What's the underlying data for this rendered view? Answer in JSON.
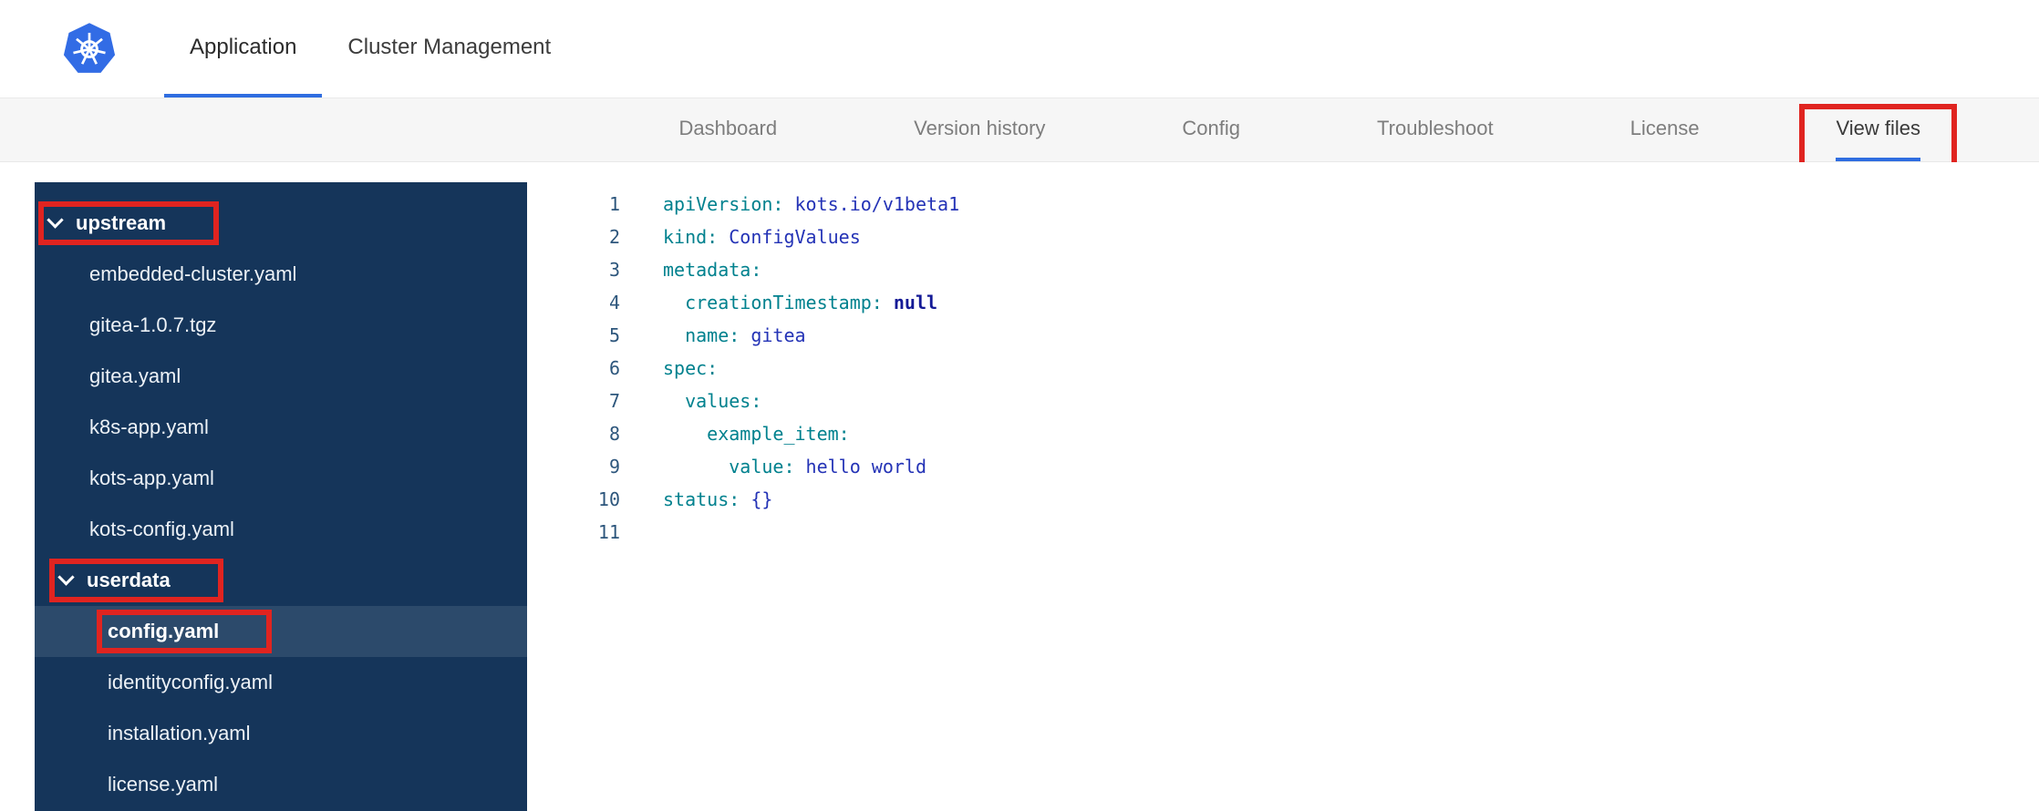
{
  "header": {
    "logo": "kubernetes-logo",
    "tabs": [
      {
        "label": "Application",
        "active": true
      },
      {
        "label": "Cluster Management",
        "active": false
      }
    ]
  },
  "subnav": {
    "tabs": [
      {
        "label": "Dashboard",
        "active": false,
        "annotated": false
      },
      {
        "label": "Version history",
        "active": false,
        "annotated": false
      },
      {
        "label": "Config",
        "active": false,
        "annotated": false
      },
      {
        "label": "Troubleshoot",
        "active": false,
        "annotated": false
      },
      {
        "label": "License",
        "active": false,
        "annotated": false
      },
      {
        "label": "View files",
        "active": true,
        "annotated": true
      }
    ]
  },
  "file_tree": {
    "items": [
      {
        "type": "folder",
        "label": "upstream",
        "expanded": true,
        "nested": false,
        "selected": false,
        "annotated": true
      },
      {
        "type": "file",
        "label": "embedded-cluster.yaml",
        "nested": false,
        "selected": false,
        "annotated": false
      },
      {
        "type": "file",
        "label": "gitea-1.0.7.tgz",
        "nested": false,
        "selected": false,
        "annotated": false
      },
      {
        "type": "file",
        "label": "gitea.yaml",
        "nested": false,
        "selected": false,
        "annotated": false
      },
      {
        "type": "file",
        "label": "k8s-app.yaml",
        "nested": false,
        "selected": false,
        "annotated": false
      },
      {
        "type": "file",
        "label": "kots-app.yaml",
        "nested": false,
        "selected": false,
        "annotated": false
      },
      {
        "type": "file",
        "label": "kots-config.yaml",
        "nested": false,
        "selected": false,
        "annotated": false
      },
      {
        "type": "folder",
        "label": "userdata",
        "expanded": true,
        "nested": true,
        "selected": false,
        "annotated": true
      },
      {
        "type": "file",
        "label": "config.yaml",
        "nested": true,
        "selected": true,
        "annotated": true
      },
      {
        "type": "file",
        "label": "identityconfig.yaml",
        "nested": true,
        "selected": false,
        "annotated": false
      },
      {
        "type": "file",
        "label": "installation.yaml",
        "nested": true,
        "selected": false,
        "annotated": false
      },
      {
        "type": "file",
        "label": "license.yaml",
        "nested": true,
        "selected": false,
        "annotated": false
      }
    ]
  },
  "editor": {
    "lines": [
      {
        "n": "1",
        "segments": [
          {
            "t": "key",
            "s": "apiVersion:"
          },
          {
            "t": "val",
            "s": " kots.io/v1beta1"
          }
        ]
      },
      {
        "n": "2",
        "segments": [
          {
            "t": "key",
            "s": "kind:"
          },
          {
            "t": "val",
            "s": " ConfigValues"
          }
        ]
      },
      {
        "n": "3",
        "segments": [
          {
            "t": "key",
            "s": "metadata:"
          }
        ]
      },
      {
        "n": "4",
        "segments": [
          {
            "t": "plain",
            "s": "  "
          },
          {
            "t": "key",
            "s": "creationTimestamp:"
          },
          {
            "t": "const",
            "s": " null"
          }
        ]
      },
      {
        "n": "5",
        "segments": [
          {
            "t": "plain",
            "s": "  "
          },
          {
            "t": "key",
            "s": "name:"
          },
          {
            "t": "val",
            "s": " gitea"
          }
        ]
      },
      {
        "n": "6",
        "segments": [
          {
            "t": "key",
            "s": "spec:"
          }
        ]
      },
      {
        "n": "7",
        "segments": [
          {
            "t": "plain",
            "s": "  "
          },
          {
            "t": "key",
            "s": "values:"
          }
        ]
      },
      {
        "n": "8",
        "segments": [
          {
            "t": "plain",
            "s": "    "
          },
          {
            "t": "key",
            "s": "example_item:"
          }
        ]
      },
      {
        "n": "9",
        "segments": [
          {
            "t": "plain",
            "s": "      "
          },
          {
            "t": "key",
            "s": "value:"
          },
          {
            "t": "val",
            "s": " hello world"
          }
        ]
      },
      {
        "n": "10",
        "segments": [
          {
            "t": "key",
            "s": "status:"
          },
          {
            "t": "val",
            "s": " {}"
          }
        ]
      },
      {
        "n": "11",
        "segments": []
      }
    ]
  },
  "annotations": {
    "color": "#e02420",
    "targets": [
      "upstream",
      "userdata",
      "config.yaml",
      "View files"
    ]
  },
  "colors": {
    "accent_blue": "#2f6de0",
    "sidebar_bg": "#15355a",
    "sidebar_selected_bg": "#2c4a6b",
    "subnav_bg": "#f6f6f6",
    "annotation_red": "#e02420",
    "code_key": "#00818e",
    "code_value": "#2433b6",
    "code_constant": "#141a96",
    "line_number": "#2d567c"
  }
}
